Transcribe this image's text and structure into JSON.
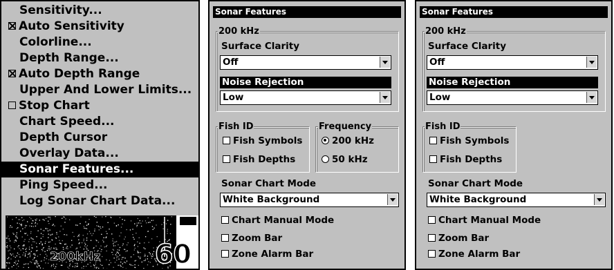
{
  "menu": {
    "items": [
      {
        "label": "Sensitivity...",
        "checkbox": false
      },
      {
        "label": "Auto Sensitivity",
        "checkbox": true,
        "checked": true
      },
      {
        "label": "Colorline...",
        "checkbox": false
      },
      {
        "label": "Depth Range...",
        "checkbox": false
      },
      {
        "label": "Auto Depth Range",
        "checkbox": true,
        "checked": true
      },
      {
        "label": "Upper And Lower Limits...",
        "checkbox": false
      },
      {
        "label": "Stop Chart",
        "checkbox": true,
        "checked": false
      },
      {
        "label": "Chart Speed...",
        "checkbox": false
      },
      {
        "label": "Depth Cursor",
        "checkbox": false
      },
      {
        "label": "Overlay Data...",
        "checkbox": false
      },
      {
        "label": "Sonar Features...",
        "checkbox": false,
        "selected": true
      },
      {
        "label": "Ping Speed...",
        "checkbox": false
      },
      {
        "label": "Log Sonar Chart Data...",
        "checkbox": false
      }
    ],
    "preview": {
      "frequency": "200kHz",
      "depth": "60"
    }
  },
  "dialog1": {
    "title": "Sonar Features",
    "group_200khz": "200 kHz",
    "surface_clarity_label": "Surface Clarity",
    "surface_clarity_value": "Off",
    "noise_rejection_label": "Noise Rejection",
    "noise_rejection_value": "Low",
    "fish_id_label": "Fish ID",
    "fish_symbols": "Fish Symbols",
    "fish_depths": "Fish Depths",
    "frequency_label": "Frequency",
    "freq_200": "200 kHz",
    "freq_50": "50 kHz",
    "chart_mode_label": "Sonar Chart Mode",
    "chart_mode_value": "White Background",
    "chart_manual_mode": "Chart Manual Mode",
    "zoom_bar": "Zoom Bar",
    "zone_alarm_bar": "Zone Alarm Bar"
  },
  "dialog2": {
    "title": "Sonar Features",
    "group_200khz": "200 kHz",
    "surface_clarity_label": "Surface Clarity",
    "surface_clarity_value": "Off",
    "noise_rejection_label": "Noise Rejection",
    "noise_rejection_value": "Low",
    "fish_id_label": "Fish ID",
    "fish_symbols": "Fish Symbols",
    "fish_depths": "Fish Depths",
    "chart_mode_label": "Sonar Chart Mode",
    "chart_mode_value": "White Background",
    "chart_manual_mode": "Chart Manual Mode",
    "zoom_bar": "Zoom Bar",
    "zone_alarm_bar": "Zone Alarm Bar"
  }
}
